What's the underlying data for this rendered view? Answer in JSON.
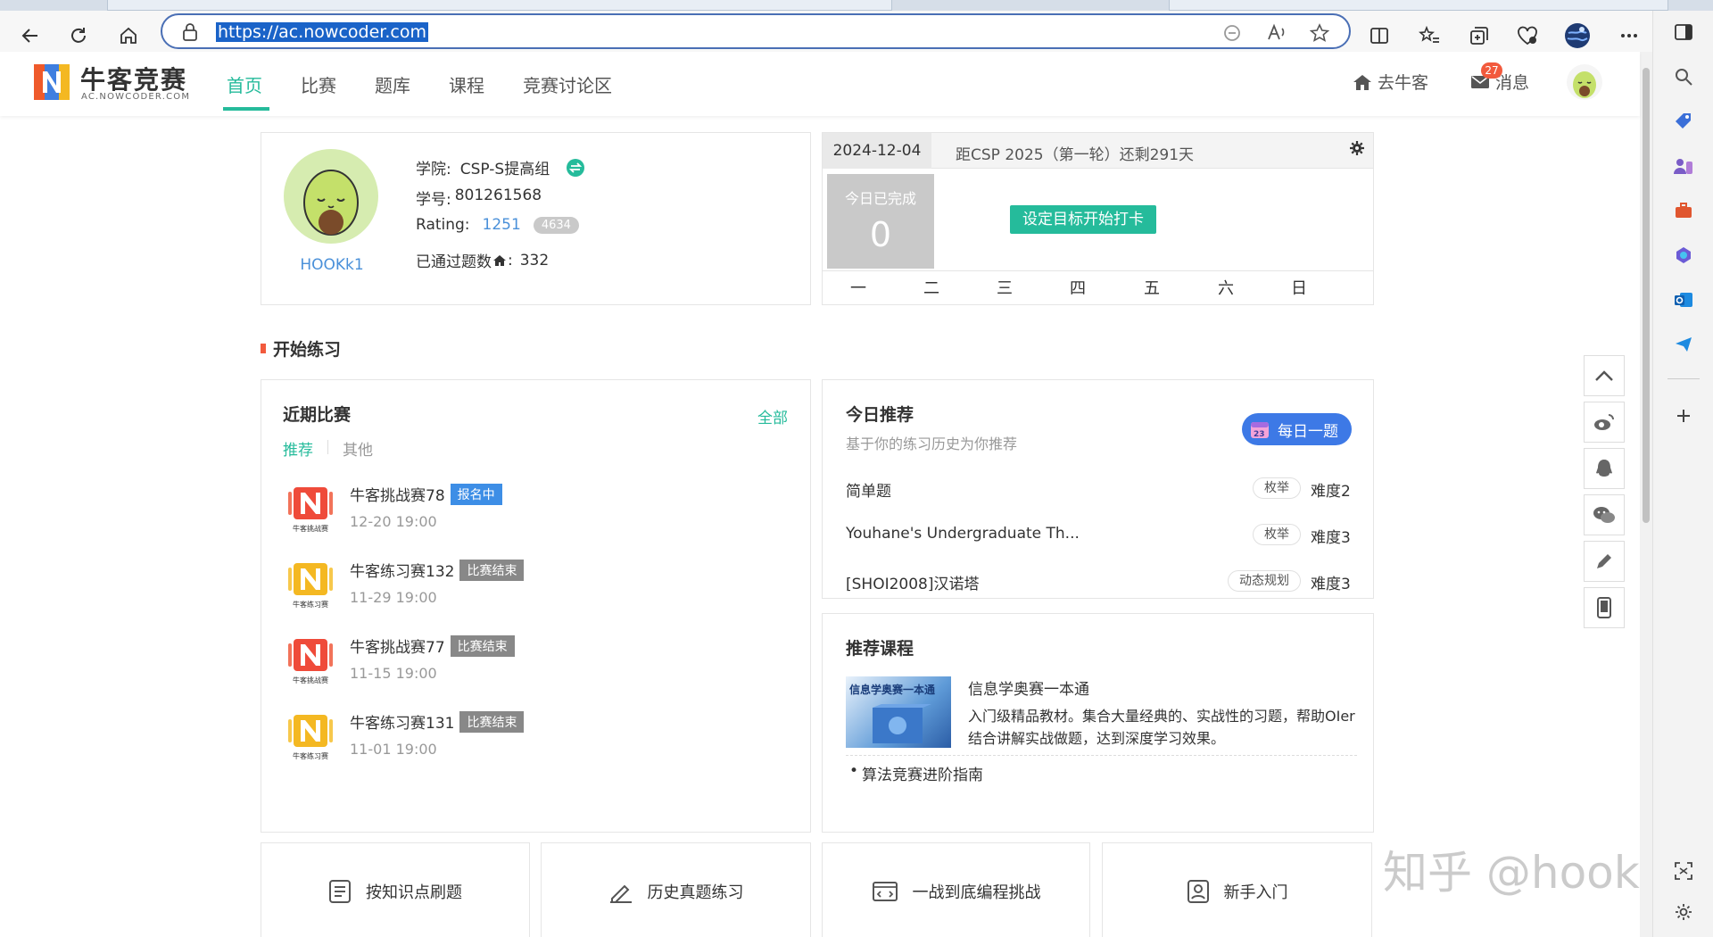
{
  "browser": {
    "url": "https://ac.nowcoder.com"
  },
  "site": {
    "brand_name": "牛客竞赛",
    "brand_sub": "AC.NOWCODER.COM",
    "nav": [
      "首页",
      "比赛",
      "题库",
      "课程",
      "竞赛讨论区"
    ],
    "go_nowcoder": "去牛客",
    "messages_label": "消息",
    "messages_count": "27"
  },
  "profile": {
    "username": "HOOKk1",
    "college_label": "学院:",
    "college_value": "CSP-S提高组",
    "id_label": "学号:",
    "id_value": "801261568",
    "rating_label": "Rating:",
    "rating_value": "1251",
    "rating_rank": "4634",
    "solved_label": "已通过题数",
    "solved_value": "332"
  },
  "checkin": {
    "date": "2024-12-04",
    "countdown": "距CSP 2025（第一轮）还剩291天",
    "today_done_label": "今日已完成",
    "today_done_value": "0",
    "start_button": "设定目标开始打卡",
    "weekdays": [
      "一",
      "二",
      "三",
      "四",
      "五",
      "六",
      "日"
    ]
  },
  "practice": {
    "section_title": "开始练习"
  },
  "contests": {
    "title": "近期比赛",
    "all_link": "全部",
    "tabs": [
      "推荐",
      "其他"
    ],
    "items": [
      {
        "name": "牛客挑战赛78",
        "status": "报名中",
        "time": "12-20 19:00",
        "logo_caption": "牛客挑战赛"
      },
      {
        "name": "牛客练习赛132",
        "status": "比赛结束",
        "time": "11-29 19:00",
        "logo_caption": "牛客练习赛"
      },
      {
        "name": "牛客挑战赛77",
        "status": "比赛结束",
        "time": "11-15 19:00",
        "logo_caption": "牛客挑战赛"
      },
      {
        "name": "牛客练习赛131",
        "status": "比赛结束",
        "time": "11-01 19:00",
        "logo_caption": "牛客练习赛"
      }
    ],
    "colors": {
      "signup": "#3d8ee6",
      "ended": "#888888"
    }
  },
  "recommend": {
    "title": "今日推荐",
    "subtitle": "基于你的练习历史为你推荐",
    "daily_button": "每日一题",
    "calendar_day": "23",
    "items": [
      {
        "name": "简单题",
        "tag": "枚举",
        "difficulty": "难度2"
      },
      {
        "name": "Youhane's Undergraduate Th...",
        "tag": "枚举",
        "difficulty": "难度3"
      },
      {
        "name": "[SHOI2008]汉诺塔",
        "tag": "动态规划",
        "difficulty": "难度3"
      }
    ]
  },
  "courses": {
    "title": "推荐课程",
    "cover_text": "信息学奥赛一本通",
    "course_name": "信息学奥赛一本通",
    "course_desc": "入门级精品教材。集合大量经典的、实战性的习题，帮助OIer结合讲解实战做题，达到深度学习效果。",
    "more": "算法竞赛进阶指南"
  },
  "quick_links": [
    "按知识点刷题",
    "历史真题练习",
    "一战到底编程挑战",
    "新手入门"
  ],
  "watermark": "知乎 @hook",
  "accent": "#25bb9b"
}
